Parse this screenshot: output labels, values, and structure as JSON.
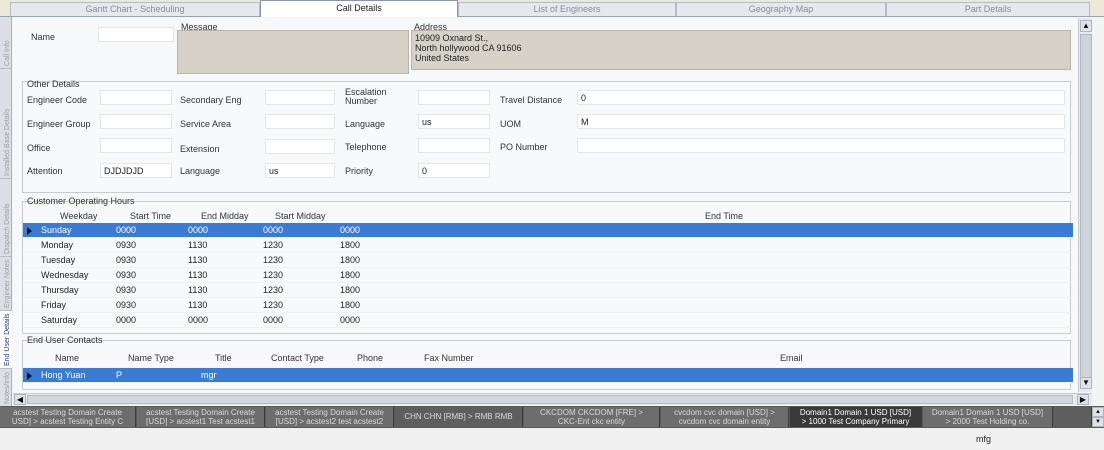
{
  "tabs": [
    {
      "label": "Gantt Chart - Scheduling",
      "active": false
    },
    {
      "label": "Call Details",
      "active": true
    },
    {
      "label": "List of Engineers",
      "active": false
    },
    {
      "label": "Geography Map",
      "active": false
    },
    {
      "label": "Part Details",
      "active": false
    }
  ],
  "side_tabs": [
    "Call Info",
    "Installed Base Details",
    "Dispatch Details",
    "Engineer Notes",
    "End User Details",
    "Notes/Info"
  ],
  "header": {
    "name_label": "Name",
    "name_value": "",
    "message_label": "Message",
    "message_value": "",
    "address_label": "Address",
    "address_line1": "10909 Oxnard St.,",
    "address_line2": "North hollywood  CA  91606",
    "address_line3": "United States"
  },
  "other_details": {
    "title": "Other Details",
    "engineer_code_label": "Engineer Code",
    "engineer_code_value": "",
    "secondary_eng_label": "Secondary Eng",
    "secondary_eng_value": "",
    "escalation_label_1": "Escalation",
    "escalation_label_2": "Number",
    "escalation_value": "",
    "travel_distance_label": "Travel Distance",
    "travel_distance_value": "0",
    "engineer_group_label": "Engineer Group",
    "engineer_group_value": "",
    "service_area_label": "Service Area",
    "service_area_value": "",
    "language_label": "Language",
    "language_value": "us",
    "uom_label": "UOM",
    "uom_value": "M",
    "office_label": "Office",
    "office_value": "",
    "extension_label": "Extension",
    "extension_value": "",
    "telephone_label": "Telephone",
    "telephone_value": "",
    "po_number_label": "PO Number",
    "po_number_value": "",
    "attention_label": "Attention",
    "attention_value": "DJDJDJD",
    "language2_label": "Language",
    "language2_value": "us",
    "priority_label": "Priority",
    "priority_value": "0"
  },
  "operating_hours": {
    "title": "Customer Operating Hours",
    "columns": [
      "Weekday",
      "Start Time",
      "End Midday",
      "Start Midday",
      "End Time"
    ],
    "rows": [
      [
        "Sunday",
        "0000",
        "0000",
        "0000",
        "0000"
      ],
      [
        "Monday",
        "0930",
        "1130",
        "1230",
        "1800"
      ],
      [
        "Tuesday",
        "0930",
        "1130",
        "1230",
        "1800"
      ],
      [
        "Wednesday",
        "0930",
        "1130",
        "1230",
        "1800"
      ],
      [
        "Thursday",
        "0930",
        "1130",
        "1230",
        "1800"
      ],
      [
        "Friday",
        "0930",
        "1130",
        "1230",
        "1800"
      ],
      [
        "Saturday",
        "0000",
        "0000",
        "0000",
        "0000"
      ]
    ]
  },
  "contacts": {
    "title": "End User Contacts",
    "columns": [
      "Name",
      "Name Type",
      "Title",
      "Contact Type",
      "Phone",
      "Fax Number",
      "Email"
    ],
    "rows": [
      [
        "Hong Yuan",
        "P",
        "mgr",
        "",
        "",
        "",
        ""
      ]
    ]
  },
  "domains": [
    {
      "line1": "acstest Testing Domain Create",
      "line2": "USD] > acstest Testing Entity C"
    },
    {
      "line1": "acstest Testing Domain Create",
      "line2": "[USD] > acstest1 Test acstest1"
    },
    {
      "line1": "acstest Testing Domain Create",
      "line2": "[USD] > acstest2 test acstest2"
    },
    {
      "line1": "CHN CHN [RMB] > RMB RMB",
      "line2": ""
    },
    {
      "line1": "CKCDOM CKCDOM [FRE] >",
      "line2": "CKC-Ent ckc entity"
    },
    {
      "line1": "cvcdom cvc domain [USD] >",
      "line2": "cvcdom cvc domain entity"
    },
    {
      "line1": "Domain1 Domain 1 USD [USD]",
      "line2": "> 1000 Test Company Primary"
    },
    {
      "line1": "Domain1 Domain 1 USD [USD]",
      "line2": "> 2000 Test Holding co."
    }
  ],
  "status_text": "mfg",
  "colors": {
    "selection": "#3a7bd5",
    "domain_bar": "#5a5a5a"
  }
}
